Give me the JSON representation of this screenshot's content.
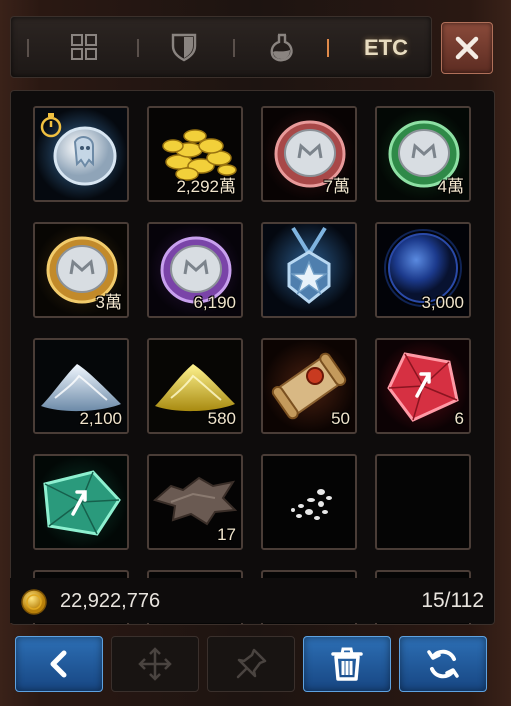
{
  "tabs": [
    {
      "name": "all",
      "icon": "grid-icon",
      "active": false
    },
    {
      "name": "equip",
      "icon": "shield-icon",
      "active": false
    },
    {
      "name": "consume",
      "icon": "potion-icon",
      "active": false
    },
    {
      "name": "etc",
      "label": "ETC",
      "active": true
    }
  ],
  "close_icon": "close-icon",
  "slots": [
    {
      "item": "ghost-coin-icon",
      "qty": "",
      "timer": true
    },
    {
      "item": "gold-pile-icon",
      "qty": "2,292萬"
    },
    {
      "item": "red-medal-coin-icon",
      "qty": "7萬"
    },
    {
      "item": "green-medal-coin-icon",
      "qty": "4萬"
    },
    {
      "item": "gold-medal-coin-icon",
      "qty": "3萬"
    },
    {
      "item": "purple-medal-coin-icon",
      "qty": "6,190"
    },
    {
      "item": "star-medal-icon",
      "qty": ""
    },
    {
      "item": "blue-orb-icon",
      "qty": "3,000"
    },
    {
      "item": "silver-powder-icon",
      "qty": "2,100"
    },
    {
      "item": "gold-powder-icon",
      "qty": "580"
    },
    {
      "item": "scroll-icon",
      "qty": "50"
    },
    {
      "item": "red-gem-icon",
      "qty": "6"
    },
    {
      "item": "green-gem-icon",
      "qty": ""
    },
    {
      "item": "leather-hide-icon",
      "qty": "17"
    },
    {
      "item": "white-fragments-icon",
      "qty": ""
    },
    {
      "item": "empty",
      "qty": ""
    }
  ],
  "footer": {
    "gold": "22,922,776",
    "capacity": "15/112"
  },
  "buttons": [
    {
      "name": "back-button",
      "icon": "chevron-left-icon",
      "style": "blue"
    },
    {
      "name": "move-button",
      "icon": "move-arrows-icon",
      "style": "dark"
    },
    {
      "name": "pin-button",
      "icon": "pin-icon",
      "style": "dark"
    },
    {
      "name": "trash-button",
      "icon": "trash-icon",
      "style": "blue"
    },
    {
      "name": "refresh-button",
      "icon": "refresh-icon",
      "style": "blue"
    }
  ],
  "colors": {
    "accent_orange": "#e08a4a",
    "button_blue": "#2d6fb5",
    "close_red": "#8a4a3a"
  }
}
